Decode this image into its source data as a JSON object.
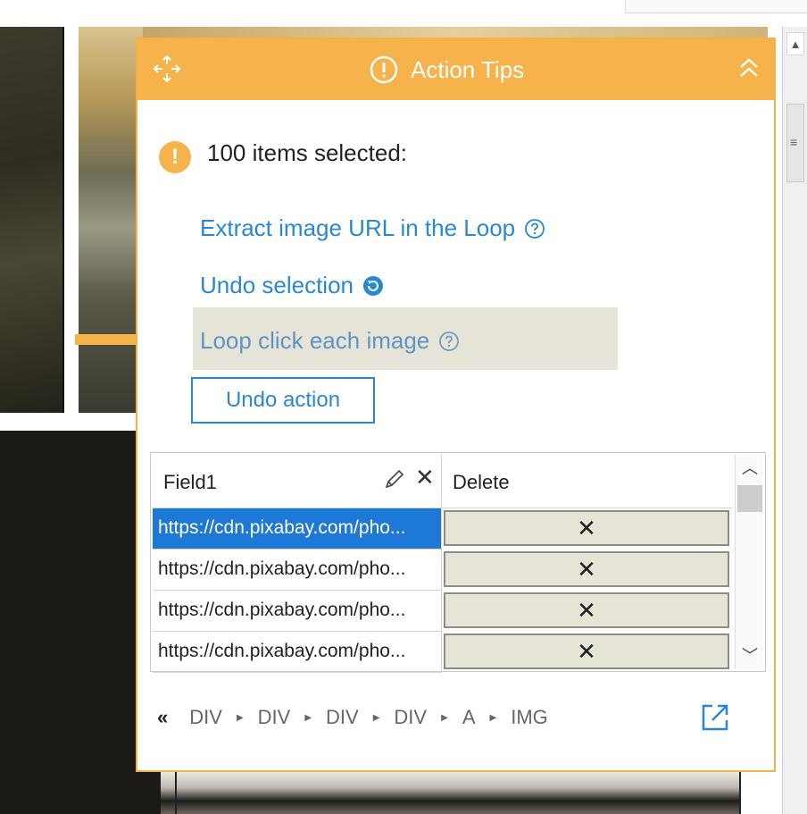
{
  "panel": {
    "title": "Action Tips",
    "selected_text": "100 items selected:",
    "warn_symbol": "!",
    "links": {
      "extract": "Extract image URL in the Loop",
      "undo_selection": "Undo selection",
      "loop_click": "Loop click each image"
    },
    "undo_action_label": "Undo action",
    "accent_color": "#f6b34c",
    "link_color": "#2a87d4"
  },
  "table": {
    "columns": [
      "Field1",
      "Delete"
    ],
    "rows": [
      {
        "url": "https://cdn.pixabay.com/pho...",
        "delete": "✕",
        "selected": true
      },
      {
        "url": "https://cdn.pixabay.com/pho...",
        "delete": "✕",
        "selected": false
      },
      {
        "url": "https://cdn.pixabay.com/pho...",
        "delete": "✕",
        "selected": false
      },
      {
        "url": "https://cdn.pixabay.com/pho...",
        "delete": "✕",
        "selected": false
      }
    ]
  },
  "breadcrumb": {
    "back_symbol": "«",
    "items": [
      "DIV",
      "DIV",
      "DIV",
      "DIV",
      "A",
      "IMG"
    ]
  },
  "icons": {
    "move": "move-icon",
    "info": "info-icon",
    "collapse": "collapse-icon",
    "help": "question-circle-icon",
    "undo": "undo-icon",
    "edit": "pencil-icon",
    "close": "close-icon",
    "external": "open-external-icon"
  }
}
